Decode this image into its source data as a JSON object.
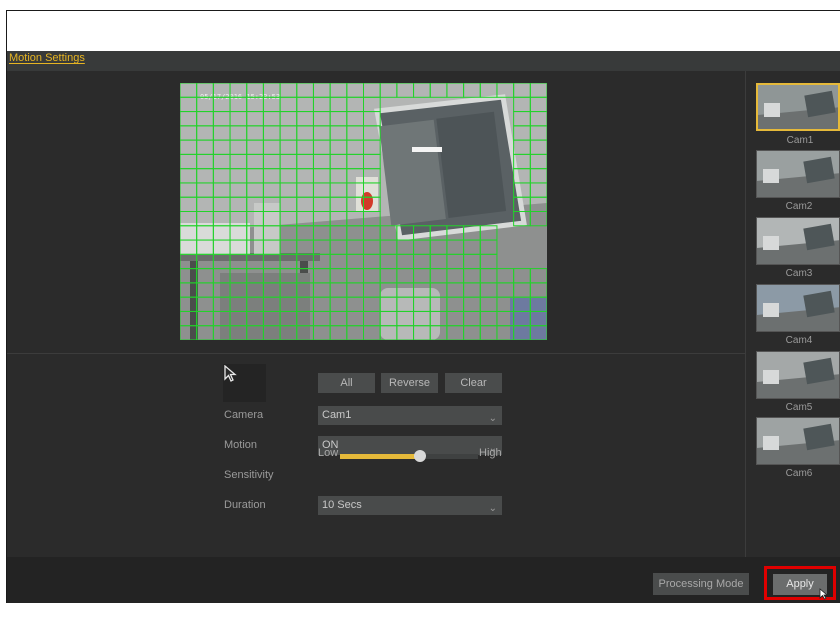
{
  "window": {
    "title": "Motion Settings"
  },
  "video": {
    "timestamp": "05/17/2016 15:23:53"
  },
  "region_tools": {
    "all_label": "All",
    "reverse_label": "Reverse",
    "clear_label": "Clear"
  },
  "form": {
    "camera": {
      "label": "Camera",
      "value": "Cam1"
    },
    "motion": {
      "label": "Motion",
      "value": "ON"
    },
    "sensitivity": {
      "label": "Sensitivity",
      "low": "Low",
      "high": "High",
      "level_fraction": 0.58
    },
    "duration": {
      "label": "Duration",
      "value": "10 Secs"
    }
  },
  "cameras": [
    {
      "label": "Cam1",
      "selected": true
    },
    {
      "label": "Cam2",
      "selected": false
    },
    {
      "label": "Cam3",
      "selected": false
    },
    {
      "label": "Cam4",
      "selected": false
    },
    {
      "label": "Cam5",
      "selected": false
    },
    {
      "label": "Cam6",
      "selected": false
    }
  ],
  "footer": {
    "processing_mode_label": "Processing Mode",
    "apply_label": "Apply"
  },
  "colors": {
    "accent": "#e5b93a",
    "grid": "#22d22a",
    "highlight": "#e00000"
  }
}
